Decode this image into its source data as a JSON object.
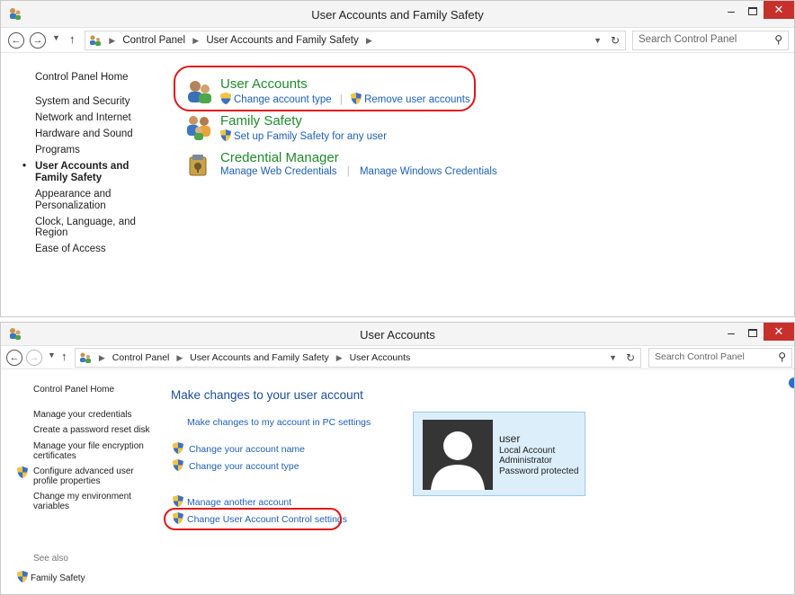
{
  "win1": {
    "title": "User Accounts and Family Safety",
    "breadcrumb": [
      "Control Panel",
      "User Accounts and Family Safety"
    ],
    "search_placeholder": "Search Control Panel",
    "nav": {
      "home": "Control Panel Home",
      "items": [
        "System and Security",
        "Network and Internet",
        "Hardware and Sound",
        "Programs"
      ],
      "current": "User Accounts and Family Safety",
      "after": [
        "Appearance and Personalization",
        "Clock, Language, and Region",
        "Ease of Access"
      ]
    },
    "categories": {
      "user_accounts": {
        "title": "User Accounts",
        "link1": "Change account type",
        "link2": "Remove user accounts"
      },
      "family_safety": {
        "title": "Family Safety",
        "link1": "Set up Family Safety for any user"
      },
      "credential_manager": {
        "title": "Credential Manager",
        "link1": "Manage Web Credentials",
        "link2": "Manage Windows Credentials"
      }
    }
  },
  "win2": {
    "title": "User Accounts",
    "breadcrumb": [
      "Control Panel",
      "User Accounts and Family Safety",
      "User Accounts"
    ],
    "search_placeholder": "Search Control Panel",
    "nav": {
      "home": "Control Panel Home",
      "items": [
        "Manage your credentials",
        "Create a password reset disk",
        "Manage your file encryption certificates",
        "Configure advanced user profile properties",
        "Change my environment variables"
      ],
      "see_also": "See also",
      "family_safety": "Family Safety"
    },
    "main": {
      "heading": "Make changes to your user account",
      "pc_settings": "Make changes to my account in PC settings",
      "change_name": "Change your account name",
      "change_type": "Change your account type",
      "manage_another": "Manage another account",
      "uac": "Change User Account Control settings"
    },
    "account": {
      "name": "user",
      "type": "Local Account",
      "role": "Administrator",
      "status": "Password protected"
    }
  },
  "colors": {
    "link": "#1e5fb4",
    "heading_green": "#1f8a2b",
    "highlight_red": "#e0161c",
    "close_red": "#c7302b"
  },
  "icons": [
    "control-panel-icon",
    "back-icon",
    "forward-icon",
    "up-icon",
    "refresh-icon",
    "search-icon",
    "uac-shield-icon",
    "user-accounts-icon",
    "family-safety-icon",
    "credential-manager-icon",
    "user-avatar-icon",
    "help-icon"
  ]
}
